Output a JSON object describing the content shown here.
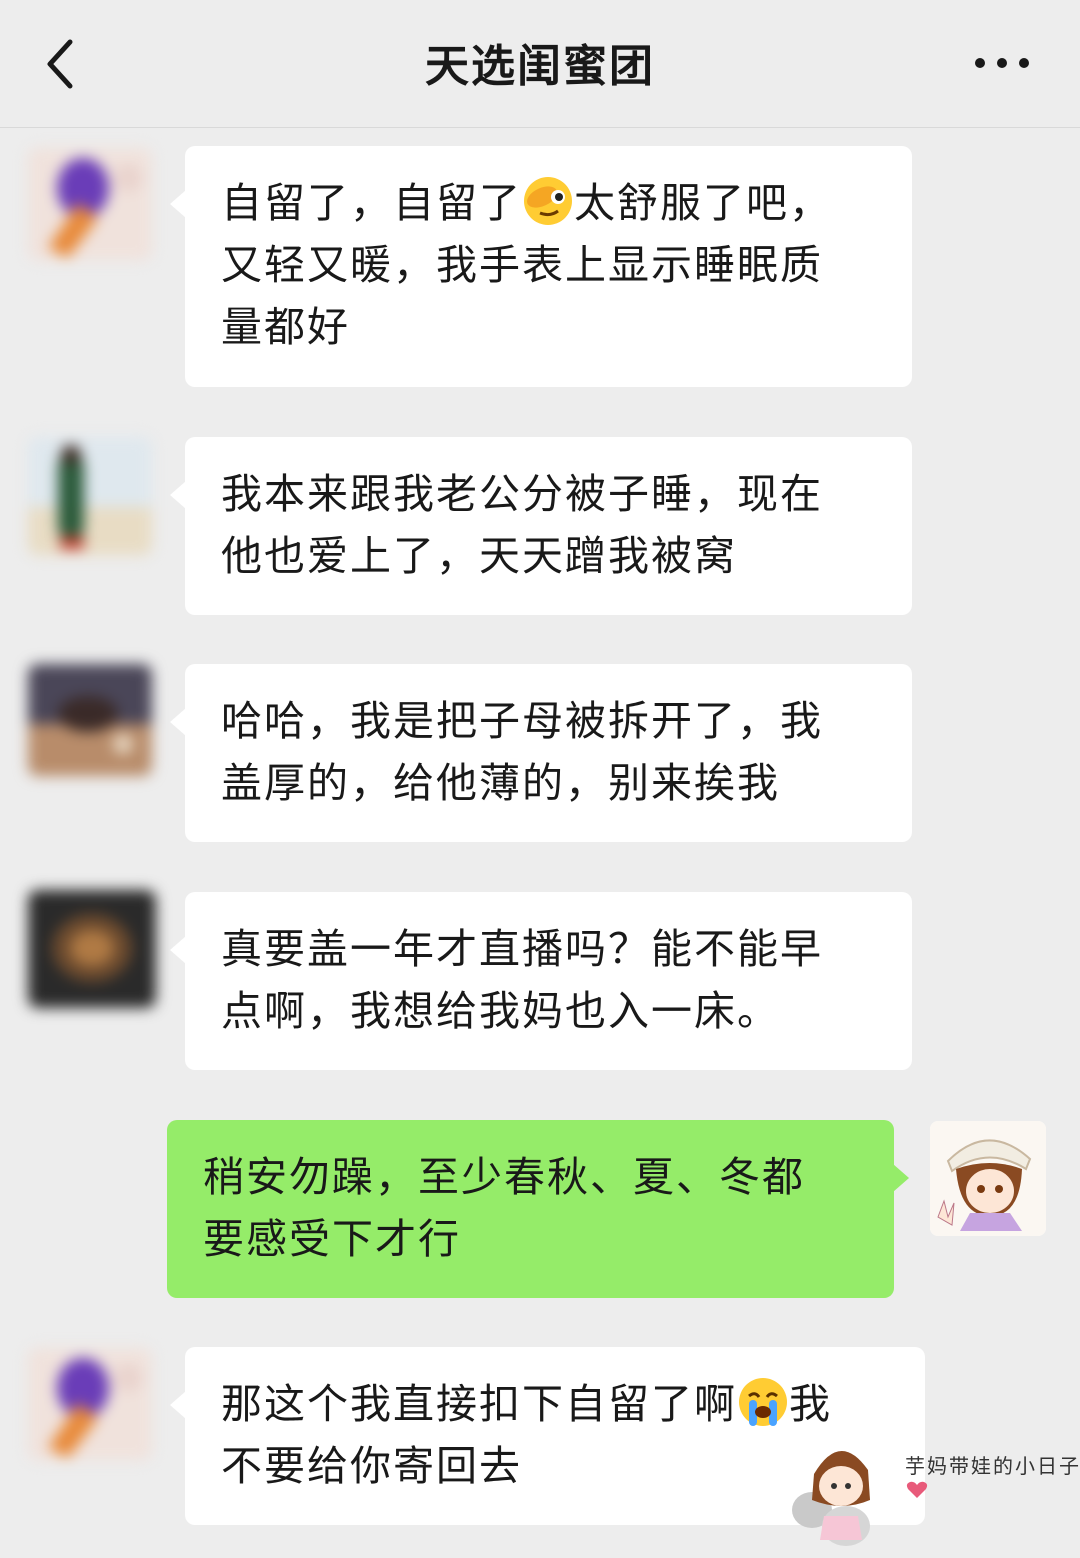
{
  "header": {
    "title": "天选闺蜜团",
    "back_icon": "chevron-left-icon",
    "more_icon": "more-dots-icon"
  },
  "messages": [
    {
      "side": "left",
      "lines": [
        "自留了，自留了",
        "太舒服了吧，",
        "又轻又暖，我手表上显示睡眠质",
        "量都好"
      ],
      "emoji": "face-with-hand-over-eye-emoji"
    },
    {
      "side": "left",
      "lines": [
        "我本来跟我老公分被子睡，现在",
        "他也爱上了，天天蹭我被窝"
      ]
    },
    {
      "side": "left",
      "lines": [
        "哈哈，我是把子母被拆开了，我",
        "盖厚的，给他薄的，别来挨我"
      ]
    },
    {
      "side": "left",
      "lines": [
        "真要盖一年才直播吗？能不能早",
        "点啊，我想给我妈也入一床。"
      ]
    },
    {
      "side": "right",
      "lines": [
        "稍安勿躁，至少春秋、夏、冬都",
        "要感受下才行"
      ]
    },
    {
      "side": "left",
      "lines": [
        "那这个我直接扣下自留了啊",
        "我",
        "不要给你寄回去"
      ],
      "emoji": "loudly-crying-face-emoji"
    }
  ],
  "watermark": {
    "text": "芋妈带娃的小日子"
  },
  "colors": {
    "background": "#ededed",
    "bubble_other": "#ffffff",
    "bubble_self": "#95ec69"
  }
}
